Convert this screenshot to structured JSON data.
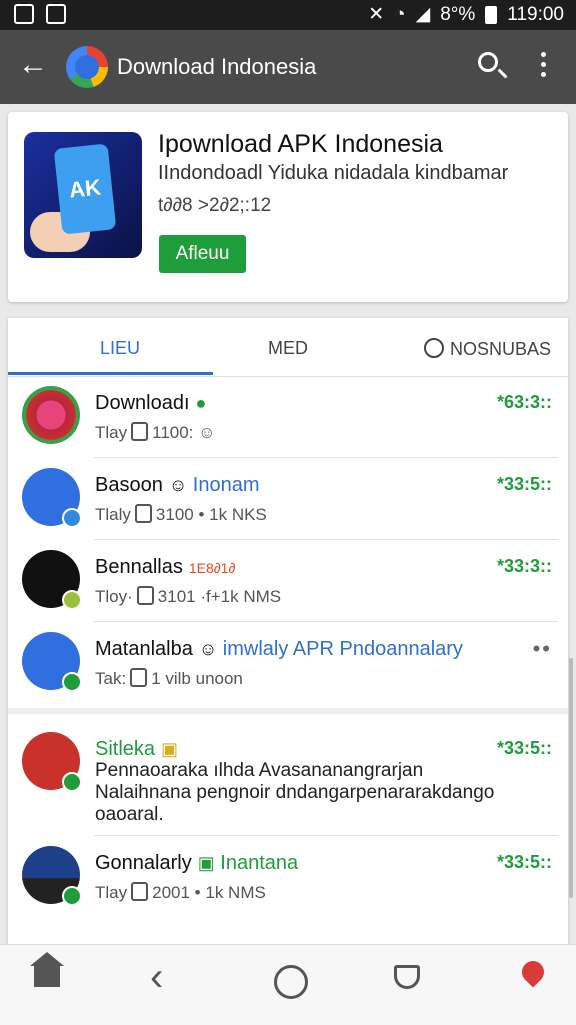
{
  "status_bar": {
    "battery": "8°%",
    "time": "119:00"
  },
  "app_bar": {
    "title": "Download Indonesia",
    "back_icon": "arrow-left-icon",
    "search_icon": "search-icon",
    "more_icon": "more-vert-icon"
  },
  "app_card": {
    "name": "Ipownload APK Indonesia",
    "subtitle": "IIndondoadl Yiduka nidadala kindbamar",
    "meta": "t∂∂8 >2∂2;:12",
    "icon_text": "AK",
    "button": "Afleuu"
  },
  "tabs": [
    {
      "label": "LIEU"
    },
    {
      "label": "MED"
    },
    {
      "label": "NOSNUBAS"
    }
  ],
  "items": [
    {
      "title": "Downloadı",
      "meta_a": "Tlay",
      "meta_b": "1100:",
      "price": "*63:3::"
    },
    {
      "title": "Basoon",
      "tag": "Inonam",
      "meta_a": "Tlaly",
      "meta_b": "3100 •",
      "meta_c": "1k NKS",
      "price": "*33:5::"
    },
    {
      "title": "Bennallas",
      "tag": "1E8∂1∂",
      "meta_a": "Tloy·",
      "meta_b": "3101 ·",
      "meta_c": "f+1k NMS",
      "price": "*33:3::"
    },
    {
      "title": "Matanlalba",
      "tag": "imwlaly APR Pndoannalary",
      "meta_a": "Tak:",
      "meta_b": "1 vilb",
      "meta_c": "unoon",
      "more": "••"
    },
    {
      "title": "Sitleka",
      "desc": "Pennaoaraka ılhda Avasananangrarjan Nalaihnana pengnoir dndangarpenararakdango oaoaral.",
      "price": "*33:5::"
    },
    {
      "title": "Gonnalarly",
      "tag": "Inantana",
      "meta_a": "Tlay",
      "meta_b": "2001 •",
      "meta_c": "1k NMS",
      "price": "*33:5::"
    }
  ],
  "bottom_nav": [
    "home-icon",
    "back-icon",
    "circle-home-icon",
    "shield-icon",
    "location-pin-icon"
  ]
}
